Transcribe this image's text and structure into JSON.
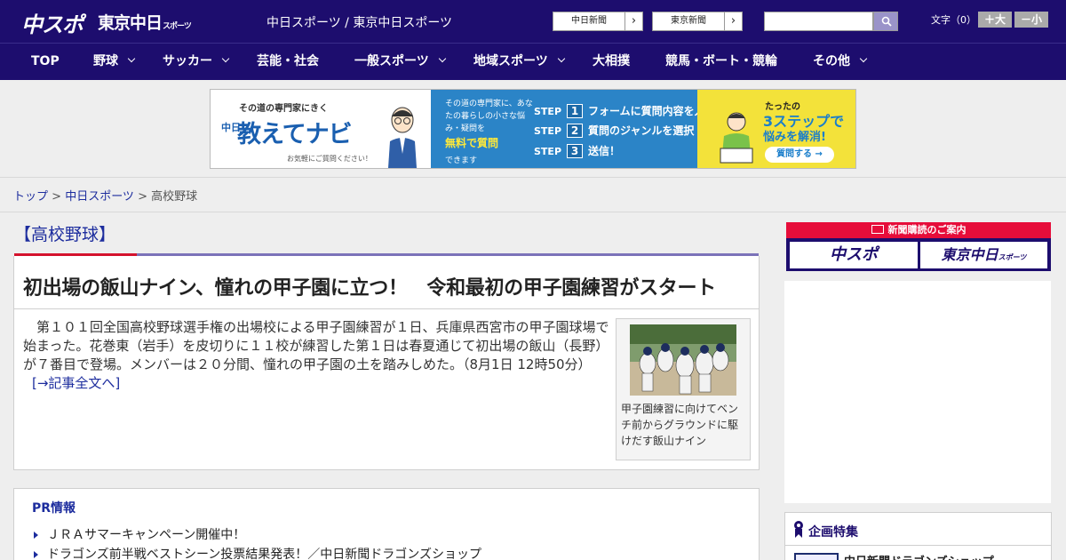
{
  "header": {
    "logo_chuspo": "中スポ",
    "logo_tokyo": "東京中日",
    "logo_tokyo_suffix": "スポーツ",
    "site_caption": "中日スポーツ / 東京中日スポーツ",
    "links": [
      {
        "label": "中日新聞",
        "arrow": "›"
      },
      {
        "label": "東京新聞",
        "arrow": "›"
      }
    ],
    "search_placeholder": "",
    "font_size_label": "文字（0）",
    "font_larger": "＋大",
    "font_smaller": "－小"
  },
  "nav": {
    "items": [
      {
        "label": "TOP",
        "has_menu": false
      },
      {
        "label": "野球",
        "has_menu": true
      },
      {
        "label": "サッカー",
        "has_menu": true
      },
      {
        "label": "芸能・社会",
        "has_menu": false
      },
      {
        "label": "一般スポーツ",
        "has_menu": true
      },
      {
        "label": "地域スポーツ",
        "has_menu": true
      },
      {
        "label": "大相撲",
        "has_menu": false
      },
      {
        "label": "競馬・ボート・競輪",
        "has_menu": false
      },
      {
        "label": "その他",
        "has_menu": true
      }
    ]
  },
  "banner": {
    "tagline": "その道の専門家にきく",
    "brand_prefix": "中日",
    "brand_name": "教えてナビ",
    "brand_note": "お気軽にご質問ください！",
    "mid_text": "その道の専門家に、あなたの暮らしの小さな悩み・疑問を",
    "mid_highlight": "無料で質問",
    "mid_suffix": "できます",
    "steps": [
      {
        "prefix": "STEP",
        "num": "1",
        "text": "フォームに質問内容を入力"
      },
      {
        "prefix": "STEP",
        "num": "2",
        "text": "質問のジャンルを選択"
      },
      {
        "prefix": "STEP",
        "num": "3",
        "text": "送信！"
      }
    ],
    "right_small": "たったの",
    "right_big": "3ステップで",
    "right_sub": "悩みを解消!",
    "right_cta": "質問する →"
  },
  "breadcrumb": {
    "top": "トップ",
    "section": "中日スポーツ",
    "current": "高校野球",
    "sep": " > "
  },
  "main": {
    "category": "【高校野球】",
    "article": {
      "title": "初出場の飯山ナイン、憧れの甲子園に立つ！　令和最初の甲子園練習がスタート",
      "body": "　第１０１回全国高校野球選手権の出場校による甲子園練習が１日、兵庫県西宮市の甲子園球場で始まった。花巻東（岩手）を皮切りに１１校が練習した第１日は春夏通じて初出場の飯山（長野）が７番目で登場。メンバーは２０分間、憧れの甲子園の土を踏みしめた。（8月1日 12時50分）",
      "more_link": "[→記事全文へ]",
      "photo_caption": "甲子園練習に向けてベンチ前からグラウンドに駆けだす飯山ナイン"
    },
    "pr": {
      "title": "PR情報",
      "items": [
        "ＪＲＡサマーキャンペーン開催中！",
        "ドラゴンズ前半戦ベストシーン投票結果発表！／中日新聞ドラゴンズショップ"
      ]
    }
  },
  "sidebar": {
    "subscription_head": "新聞購読のご案内",
    "subscription_a": "中スポ",
    "subscription_b": "東京中日",
    "subscription_b_suffix": "スポーツ",
    "kikaku_title": "企画特集",
    "kikaku_item": "中日新聞ドラゴンズショップ"
  },
  "colors": {
    "header_bg": "#1d0d6e",
    "accent_red": "#d4122d",
    "link_blue": "#1d2d9e",
    "search_button": "#9a93c9"
  }
}
